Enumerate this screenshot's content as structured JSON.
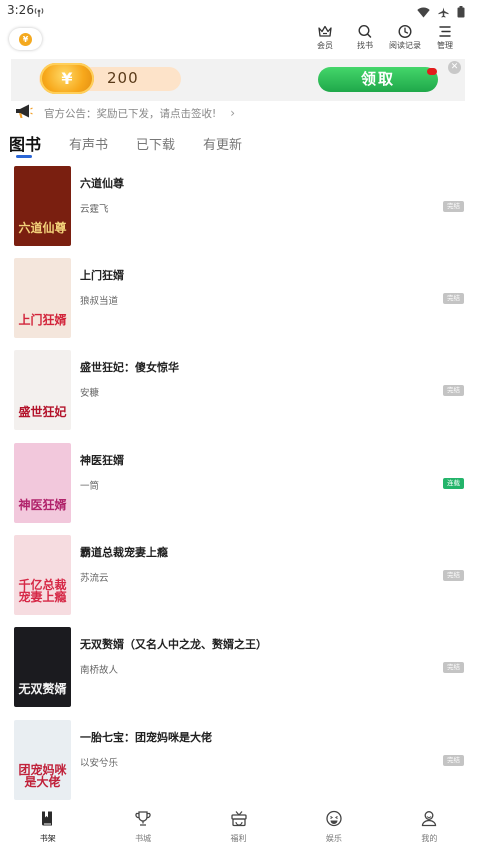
{
  "status_bar": {
    "time": "3:26"
  },
  "top_actions": [
    {
      "label": "会员",
      "icon": "crown-icon"
    },
    {
      "label": "找书",
      "icon": "search-icon"
    },
    {
      "label": "阅读记录",
      "icon": "clock-icon"
    },
    {
      "label": "管理",
      "icon": "menu-icon"
    }
  ],
  "banner": {
    "coin_symbol": "¥",
    "amount": "200",
    "button_label": "领取"
  },
  "notice": {
    "text": "官方公告：奖励已下发，请点击签收!",
    "arrow": "›"
  },
  "tabs": [
    {
      "label": "图书",
      "active": true
    },
    {
      "label": "有声书",
      "active": false
    },
    {
      "label": "已下载",
      "active": false
    },
    {
      "label": "有更新",
      "active": false
    }
  ],
  "books": [
    {
      "title": "六道仙尊",
      "author": "云霆飞",
      "status": "完结",
      "cover_text": "六道仙尊",
      "cover_bg": "#7a1f10",
      "cover_fg": "#f3d27a"
    },
    {
      "title": "上门狂婿",
      "author": "狼叔当道",
      "status": "完结",
      "cover_text": "上门狂婿",
      "cover_bg": "#f4e6dc",
      "cover_fg": "#d2243a"
    },
    {
      "title": "盛世狂妃：傻女惊华",
      "author": "安糠",
      "status": "完结",
      "cover_text": "盛世狂妃",
      "cover_bg": "#f3f0ee",
      "cover_fg": "#b3122a"
    },
    {
      "title": "神医狂婿",
      "author": "一筒",
      "status": "连载",
      "cover_text": "神医狂婿",
      "cover_bg": "#f2c8dc",
      "cover_fg": "#b0226a"
    },
    {
      "title": "霸道总裁宠妻上瘾",
      "author": "苏流云",
      "status": "完结",
      "cover_text": "千亿总裁宠妻上瘾",
      "cover_bg": "#f6dce0",
      "cover_fg": "#d62846"
    },
    {
      "title": "无双赘婿（又名人中之龙、赘婿之王）",
      "author": "南桥故人",
      "status": "完结",
      "cover_text": "无双赘婿",
      "cover_bg": "#1b1b1f",
      "cover_fg": "#f2f2f2"
    },
    {
      "title": "一胎七宝：团宠妈咪是大佬",
      "author": "以安兮乐",
      "status": "完结",
      "cover_text": "团宠妈咪是大佬",
      "cover_bg": "#e9eef2",
      "cover_fg": "#c0213a"
    }
  ],
  "bottom_nav": [
    {
      "label": "书架",
      "icon": "bookshelf-icon",
      "active": true
    },
    {
      "label": "书城",
      "icon": "trophy-icon",
      "active": false
    },
    {
      "label": "福利",
      "icon": "gift-icon",
      "active": false
    },
    {
      "label": "娱乐",
      "icon": "smile-icon",
      "active": false
    },
    {
      "label": "我的",
      "icon": "user-icon",
      "active": false
    }
  ]
}
